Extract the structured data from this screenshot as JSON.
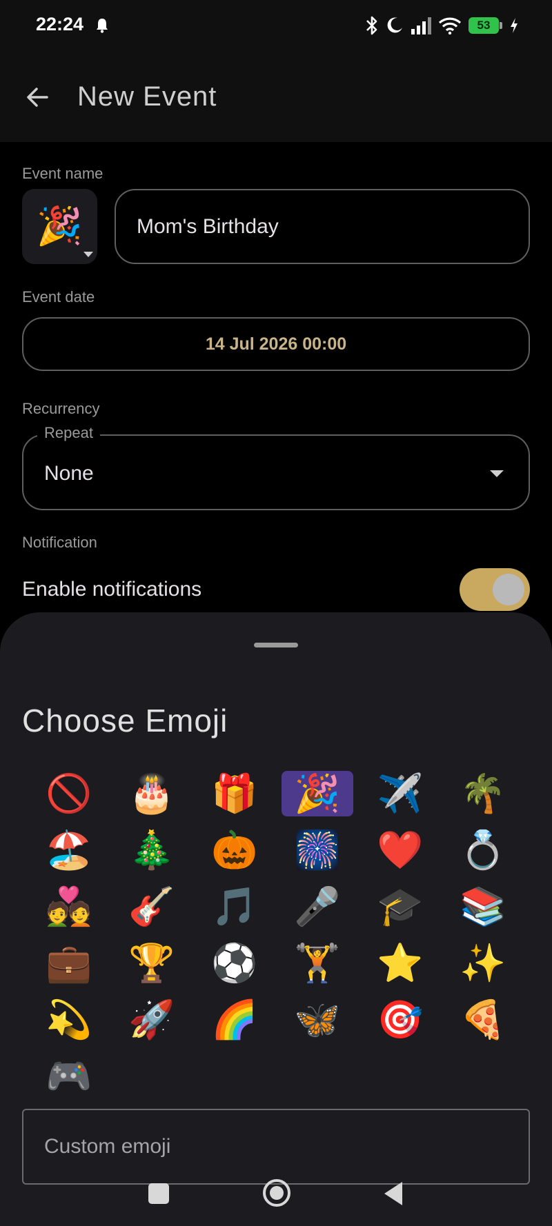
{
  "status_bar": {
    "time": "22:24",
    "battery": "53",
    "icons": [
      "bell-icon",
      "bluetooth-icon",
      "do-not-disturb-icon",
      "signal-icon",
      "wifi-icon",
      "battery-icon",
      "charging-icon"
    ]
  },
  "app_bar": {
    "title": "New Event",
    "back_icon": "arrow-left-icon"
  },
  "form": {
    "event_name_label": "Event name",
    "event_emoji": "🎉",
    "event_name_value": "Mom's Birthday",
    "event_date_label": "Event date",
    "event_date_value": "14 Jul 2026 00:00",
    "recurrency_label": "Recurrency",
    "repeat_legend": "Repeat",
    "repeat_value": "None",
    "notification_label": "Notification",
    "enable_notifications_label": "Enable notifications",
    "notifications_enabled": true
  },
  "emoji_sheet": {
    "title": "Choose Emoji",
    "selected_index": 3,
    "emojis": [
      "🚫",
      "🎂",
      "🎁",
      "🎉",
      "✈️",
      "🌴",
      "🏖️",
      "🎄",
      "🎃",
      "🎆",
      "❤️",
      "💍",
      "💑",
      "🎸",
      "🎵",
      "🎤",
      "🎓",
      "📚",
      "💼",
      "🏆",
      "⚽",
      "🏋️",
      "⭐",
      "✨",
      "💫",
      "🚀",
      "🌈",
      "🦋",
      "🎯",
      "🍕",
      "🎮"
    ],
    "custom_placeholder": "Custom emoji"
  },
  "colors": {
    "accent": "#c9a85f",
    "date_text": "#c9b488",
    "sheet_bg": "#1c1b1f",
    "selected_bg": "#4d3a8c",
    "battery_green": "#30c24a"
  }
}
